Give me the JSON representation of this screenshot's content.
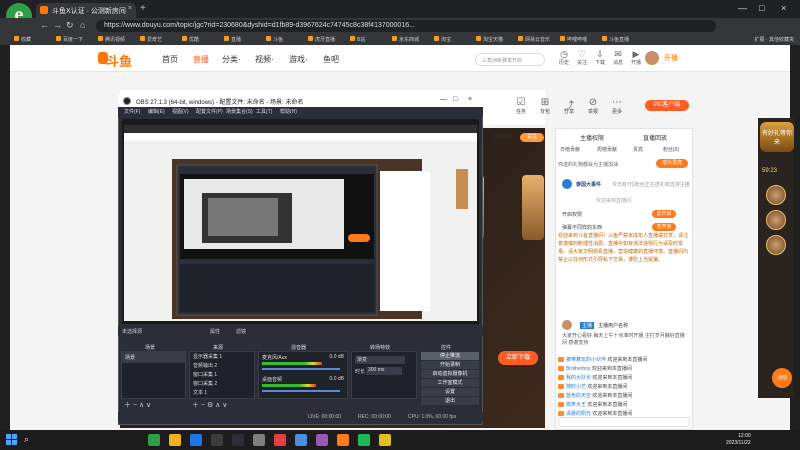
{
  "browser": {
    "tab_title": "斗鱼X认证 · 公测新房间",
    "tab_close": "×",
    "new_tab": "+",
    "url": "https://www.douyu.com/topic/jgc?rid=230680&dyshid=d1fb89-d3967624c74745c8c38f4137000016...",
    "nav": {
      "back": "←",
      "forward": "→",
      "refresh": "↻",
      "home": "⌂"
    },
    "window": {
      "minimize": "—",
      "maximize": "□",
      "close": "×"
    },
    "bookmarks": [
      "收藏",
      "百度一下",
      "腾讯视频",
      "爱奇艺",
      "优酷",
      "直播",
      "斗鱼",
      "虎牙直播",
      "B站",
      "京东商城",
      "淘宝",
      "淘宝天猫",
      "网易云音乐",
      "哔哩哔哩",
      "斗鱼直播"
    ],
    "bookmarks_right": "扩展 · 其他收藏夹"
  },
  "site": {
    "brand": "斗鱼",
    "nav": [
      {
        "label": "首页",
        "active": false
      },
      {
        "label": "直播",
        "active": true
      },
      {
        "label": "分类·",
        "active": false
      },
      {
        "label": "视频·",
        "active": false
      },
      {
        "label": "游戏·",
        "active": false
      },
      {
        "label": "鱼吧",
        "active": false
      }
    ],
    "search_placeholder": "三角洲新赛季开启",
    "header_icons": [
      {
        "icon": "history-icon",
        "glyph": "◷",
        "label": "历史"
      },
      {
        "icon": "follow-icon",
        "glyph": "♡",
        "label": "关注"
      },
      {
        "icon": "download-icon",
        "glyph": "⇩",
        "label": "下载"
      },
      {
        "icon": "message-icon",
        "glyph": "✉",
        "label": "消息"
      },
      {
        "icon": "start-live-icon",
        "glyph": "▶",
        "label": "开播"
      }
    ],
    "open_live": "开播"
  },
  "room": {
    "actions": [
      {
        "icon": "task-icon",
        "glyph": "☑",
        "label": "任务"
      },
      {
        "icon": "gift-icon",
        "glyph": "⊞",
        "label": "背包"
      },
      {
        "icon": "share-icon",
        "glyph": "⤴",
        "label": "分享"
      },
      {
        "icon": "report-icon",
        "glyph": "⊘",
        "label": "举报"
      },
      {
        "icon": "more-icon",
        "glyph": "⋯",
        "label": "更多"
      }
    ],
    "pc_client": "PC客户端",
    "follow_count": "999999",
    "follow_btn": "关注",
    "download_btn": "立即下载"
  },
  "chat": {
    "tabs": [
      "主播权限",
      "直播回放"
    ],
    "subtabs": [
      "日榜贡献",
      "周榜贡献",
      "贵宾",
      "粉丝(9)"
    ],
    "rank_notice": "你送的礼物都会为主播加油",
    "rank_btn": "成为贵宾",
    "event_title": "泰国大事件",
    "event_sub": "今日有7位粉丝正在送礼物支持主播",
    "welcome": "欢迎来到直播间",
    "rows": [
      {
        "name": "开启权限",
        "btn": "去开启"
      },
      {
        "name": "弹幕不同样的东西",
        "btn": "去开启"
      }
    ],
    "notice": "欢迎来到斗鱼直播间！斗鱼严禁未成年人直播或打赏，请注意谨慎判断理性消费。直播中如有违法违规行为请及时举报。请大家文明观看直播，营造健康的直播环境。直播间内禁止以任何形式引导私下交易，谨防上当受骗。",
    "anchor_label": "主播",
    "anchor_name": "主播用户名称",
    "anchor_msg": "大家开心看好 每天上午十点准时开播 主打岁月静好直播间 感谢支持",
    "messages": [
      {
        "level": "8",
        "user": "被带着玩的小伙伴",
        "text": "欢迎来到本直播间"
      },
      {
        "level": "12",
        "user": "Brotherboy",
        "text": "欢迎来到本直播间"
      },
      {
        "level": "5",
        "user": "我的大队长",
        "text": "欢迎来到本直播间"
      },
      {
        "level": "3",
        "user": "随时小艺",
        "text": "欢迎来到本直播间"
      },
      {
        "level": "9",
        "user": "蓝色的天空",
        "text": "欢迎来到本直播间"
      },
      {
        "level": "7",
        "user": "搞笑大王",
        "text": "欢迎来到本直播间"
      },
      {
        "level": "6",
        "user": "清晨的阳光",
        "text": "欢迎来到本直播间"
      }
    ]
  },
  "promo": {
    "badge": "有好礼等你来",
    "time": "59:23",
    "float_btn": "活动"
  },
  "obs": {
    "title": "OBS 27.1.3 (64-bit, windows) - 配置文件: 未命名 - 场景: 未命名",
    "menu": [
      "文件(F)",
      "编辑(E)",
      "视图(V)",
      "配置文件(P)",
      "场景集合(S)",
      "工具(T)",
      "帮助(H)"
    ],
    "status": "未选择源",
    "prop_btn": "属性",
    "filter_btn": "滤镜",
    "docks": {
      "scenes": {
        "title": "场景",
        "items": [
          "场景"
        ]
      },
      "sources": {
        "title": "来源",
        "items": [
          "显示器采集 1",
          "音频输出 2",
          "窗口采集 1",
          "窗口采集 2",
          "文本 1",
          "文本 2"
        ]
      },
      "mixer": {
        "title": "混音器",
        "tracks": [
          {
            "name": "麦克风/Aux",
            "db": "0.0 dB",
            "level": 0.72
          },
          {
            "name": "桌面音频",
            "db": "0.0 dB",
            "level": 0.64
          }
        ]
      },
      "transitions": {
        "title": "转场特效",
        "type": "渐变",
        "duration_label": "时长",
        "duration": "300 ms"
      },
      "controls": {
        "title": "控件",
        "buttons": [
          "停止推流",
          "开始录制",
          "启动虚拟摄像机",
          "工作室模式",
          "设置",
          "退出"
        ]
      }
    },
    "footer": {
      "live": "LIVE: 00:00:00",
      "rec": "REC: 00:00:00",
      "cpu": "CPU: 1.0%, 60.00 fps"
    }
  },
  "taskbar": {
    "time": "12:00",
    "date": "2023/11/22",
    "icon_colors": [
      "#2f9e44",
      "#f2b01e",
      "#1a73e8",
      "#3b3b3b",
      "#2b2e38",
      "#7f7f7f",
      "#e24040",
      "#4a90e2",
      "#9b59b6",
      "#ff7a1a",
      "#1db954",
      "#e0c020"
    ]
  }
}
